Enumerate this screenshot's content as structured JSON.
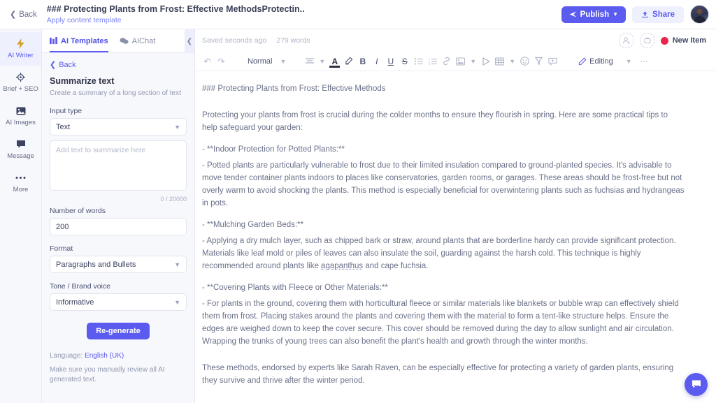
{
  "topbar": {
    "back_label": "Back",
    "doc_title": "### Protecting Plants from Frost: Effective MethodsProtectin..",
    "apply_template_label": "Apply content template",
    "publish_label": "Publish",
    "share_label": "Share"
  },
  "rail": {
    "items": [
      {
        "label": "AI Writer",
        "icon": "lightning-bolt-icon",
        "active": true
      },
      {
        "label": "Brief + SEO",
        "icon": "target-icon",
        "active": false
      },
      {
        "label": "AI Images",
        "icon": "image-icon",
        "active": false
      },
      {
        "label": "Message",
        "icon": "chat-bubble-icon",
        "active": false
      },
      {
        "label": "More",
        "icon": "ellipsis-icon",
        "active": false
      }
    ]
  },
  "panel": {
    "tabs": [
      {
        "label": "AI Templates",
        "icon": "grid-icon",
        "active": true
      },
      {
        "label": "AIChat",
        "icon": "chats-icon",
        "active": false
      }
    ],
    "back_label": "Back",
    "template_name": "Summarize text",
    "template_desc": "Create a summary of a long section of text",
    "fields": {
      "input_type": {
        "label": "Input type",
        "value": "Text"
      },
      "source_text": {
        "placeholder": "Add text to summarize here",
        "value": "",
        "counter": "0 / 20000"
      },
      "number_of_words": {
        "label": "Number of words",
        "value": "200"
      },
      "format": {
        "label": "Format",
        "value": "Paragraphs and Bullets"
      },
      "tone": {
        "label": "Tone / Brand voice",
        "value": "Informative"
      }
    },
    "regenerate_label": "Re-generate",
    "language_prefix": "Language:",
    "language_value": "English (UK)",
    "disclaimer": "Make sure you manually review all AI generated text."
  },
  "editor": {
    "saved_status": "Saved seconds ago",
    "word_count": "279 words",
    "new_item_label": "New Item",
    "new_item_color": "#e8254b",
    "toolbar": {
      "undo": "↺",
      "redo": "↻",
      "style_value": "Normal",
      "editing_label": "Editing",
      "items": [
        "undo-icon",
        "redo-icon",
        "paragraph-style-select",
        "align-icon",
        "text-color-icon",
        "highlighter-icon",
        "bold-icon",
        "italic-icon",
        "underline-icon",
        "strikethrough-icon",
        "bullet-list-icon",
        "numbered-list-icon",
        "link-icon",
        "image-icon",
        "video-icon",
        "table-icon",
        "emoji-icon",
        "clear-format-icon",
        "comment-icon",
        "editing-mode",
        "more-icon"
      ]
    },
    "document": [
      {
        "id": "heading",
        "text": "### Protecting Plants from Frost: Effective Methods"
      },
      {
        "id": "intro",
        "text": "Protecting your plants from frost is crucial during the colder months to ensure they flourish in spring. Here are some practical tips to help safeguard your garden:"
      },
      {
        "id": "s1-title",
        "text": "- **Indoor Protection for Potted Plants:**"
      },
      {
        "id": "s1-body",
        "text": "- Potted plants are particularly vulnerable to frost due to their limited insulation compared to ground-planted species. It's advisable to move tender container plants indoors to places like conservatories, garden rooms, or garages. These areas should be frost-free but not overly warm to avoid shocking the plants. This method is especially beneficial for overwintering plants such as fuchsias and hydrangeas in pots."
      },
      {
        "id": "s2-title",
        "text": "- **Mulching Garden Beds:**"
      },
      {
        "id": "s2-body-a",
        "text": "- Applying a dry mulch layer, such as chipped bark or straw, around plants that are borderline hardy can provide significant protection. Materials like leaf mold or piles of leaves can also insulate the soil, guarding against the harsh cold. This technique is highly recommended around plants like "
      },
      {
        "id": "s2-misspelled",
        "text": "agapanthus"
      },
      {
        "id": "s2-body-b",
        "text": " and cape fuchsia."
      },
      {
        "id": "s3-title",
        "text": "- **Covering Plants with Fleece or Other Materials:**"
      },
      {
        "id": "s3-body",
        "text": "- For plants in the ground, covering them with horticultural fleece or similar materials like blankets or bubble wrap can effectively shield them from frost. Placing stakes around the plants and covering them with the material to form a tent-like structure helps. Ensure the edges are weighed down to keep the cover secure. This cover should be removed during the day to allow sunlight and air circulation. Wrapping the trunks of young trees can also benefit the plant's health and growth through the winter months."
      },
      {
        "id": "closing",
        "text": "These methods, endorsed by experts like Sarah Raven, can be especially effective for protecting a variety of garden plants, ensuring they survive and thrive after the winter period."
      }
    ]
  },
  "colors": {
    "accent": "#5b5bf0",
    "accent_soft": "#eef0fe",
    "status_red": "#e8254b",
    "panel_bg": "#f7f8fc",
    "text": "#3d4461",
    "muted": "#9399b2"
  }
}
